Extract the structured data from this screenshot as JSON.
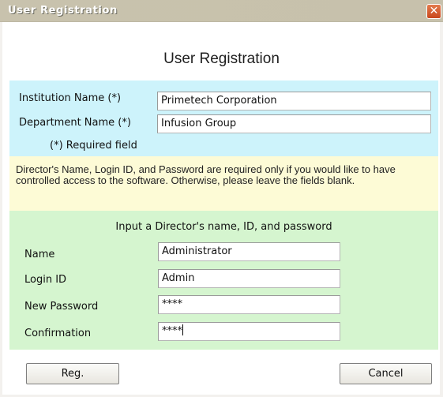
{
  "window": {
    "title": "User Registration",
    "close_label": "✕"
  },
  "heading": "User Registration",
  "institution": {
    "label": "Institution Name (*)",
    "value": "Primetech Corporation"
  },
  "department": {
    "label": "Department Name (*)",
    "value": "Infusion Group"
  },
  "required_note": "(*) Required field",
  "info_text": "Director's Name, Login ID, and Password are required only if you would like to have controlled access to the software. Otherwise, please leave the fields blank.",
  "director": {
    "subheading": "Input a Director's name, ID, and password",
    "name_label": "Name",
    "name_value": "Administrator",
    "login_label": "Login ID",
    "login_value": "Admin",
    "password_label": "New Password",
    "password_value": "****",
    "confirm_label": "Confirmation",
    "confirm_value": "****"
  },
  "buttons": {
    "register": "Reg.",
    "cancel": "Cancel"
  },
  "colors": {
    "required_section": "#cdf3fb",
    "info_section": "#fdfbd6",
    "director_section": "#d5f5cf",
    "close_button": "#d0532a"
  }
}
